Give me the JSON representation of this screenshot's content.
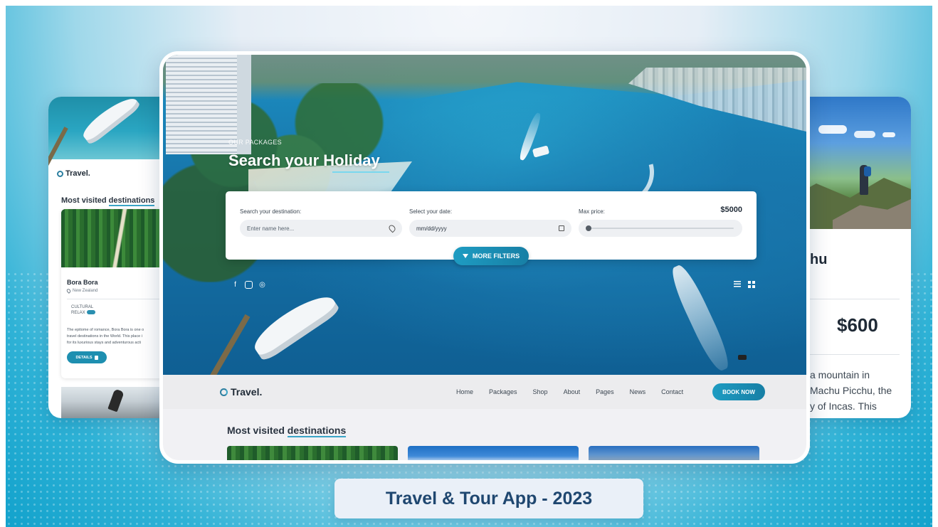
{
  "left_card": {
    "brand": "Travel.",
    "section_title_prefix": "Most visited ",
    "section_title_highlight": "destinations",
    "destination_name": "Bora Bora",
    "destination_location": "New Zealand",
    "tag_line1": "CULTURAL",
    "tag_line2": "RELAX",
    "price_partial": "$",
    "description": [
      "The epitome of romance, Bora Bora is one o",
      "travel destinations in the World. This place i",
      "for its luxurious stays and adventurous acti"
    ],
    "details_label": "DETAILS"
  },
  "right_card": {
    "title_partial": "hu",
    "price": "$600",
    "description": [
      "a mountain in",
      "Machu Picchu, the",
      "y of Incas. This"
    ]
  },
  "main": {
    "eyebrow": "OUR PACKAGES",
    "hero_title": "Search your Holiday",
    "search": {
      "destination_label": "Search your destination:",
      "destination_placeholder": "Enter name here...",
      "date_label": "Select your date:",
      "date_value": "mm/dd/yyyy",
      "price_label": "Max price:",
      "price_value": "$5000",
      "price_fraction": 0.0,
      "more_filters_label": "MORE FILTERS"
    },
    "social_icons": [
      "facebook-icon",
      "instagram-icon",
      "tripadvisor-icon"
    ],
    "nav": {
      "brand": "Travel.",
      "links": [
        "Home",
        "Packages",
        "Shop",
        "About",
        "Pages",
        "News",
        "Contact"
      ],
      "cta": "BOOK NOW"
    },
    "section_title_prefix": "Most visited ",
    "section_title_highlight": "destinations"
  },
  "banner": {
    "title": "Travel & Tour App - 2023"
  },
  "colors": {
    "accent": "#1e9cc2",
    "text_dark": "#1f2a36",
    "banner_text": "#1f4770"
  }
}
